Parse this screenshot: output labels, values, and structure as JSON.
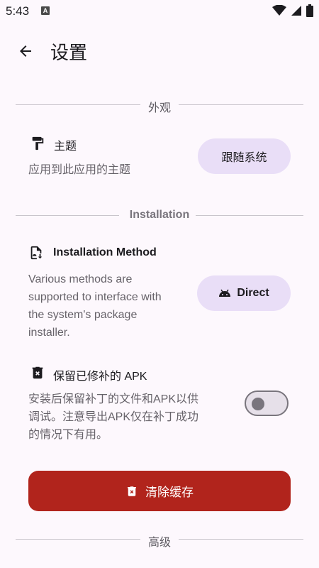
{
  "status_bar": {
    "time": "5:43",
    "notification_badge": "A"
  },
  "app_bar": {
    "title": "设置"
  },
  "sections": {
    "appearance": {
      "header": "外观"
    },
    "installation": {
      "header": "Installation"
    },
    "advanced": {
      "header": "高级"
    }
  },
  "theme": {
    "title": "主题",
    "description": "应用到此应用的主题",
    "button_label": "跟随系统"
  },
  "install_method": {
    "title": "Installation Method",
    "description_lines": [
      "Various methods are",
      "supported to interface with",
      "the system's package",
      "installer."
    ],
    "button_label": "Direct"
  },
  "keep_apk": {
    "title": "保留已修补的 APK",
    "description_lines": [
      "安装后保留补丁的文件和APK以供",
      "调试。注意导出APK仅在补丁成功",
      "的情况下有用。"
    ],
    "toggle_on": false
  },
  "clear_cache": {
    "label": "清除缓存"
  },
  "colors": {
    "background": "#fdf8fd",
    "pill": "#e9def7",
    "danger": "#b1241c"
  }
}
